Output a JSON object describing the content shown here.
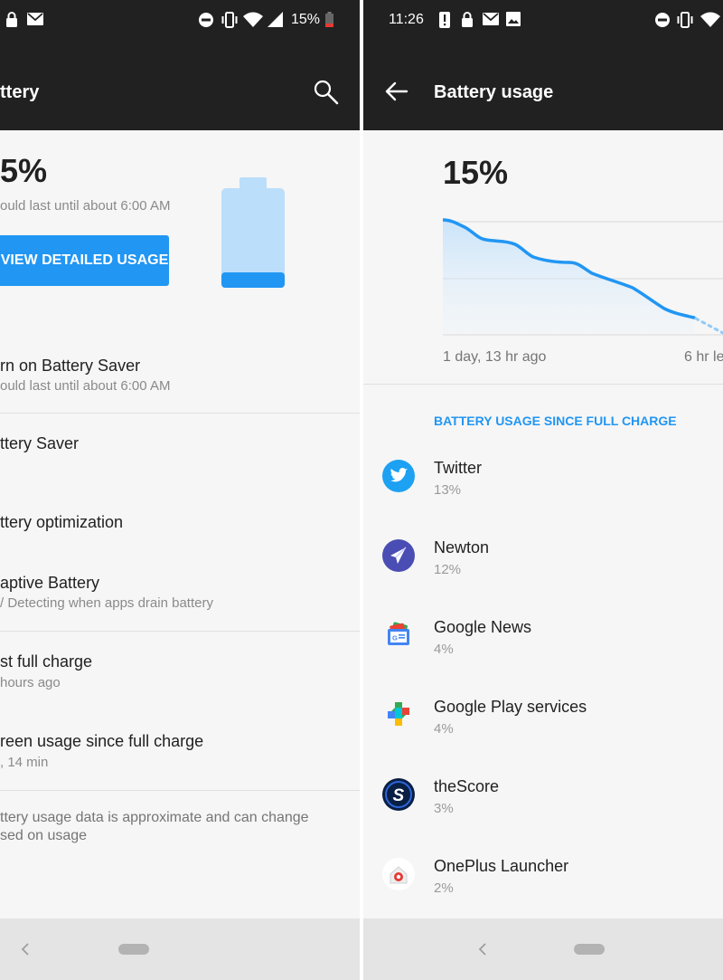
{
  "left": {
    "status": {
      "battery_text": "15%"
    },
    "toolbar": {
      "title": "ttery"
    },
    "summary": {
      "percent": "5%",
      "estimate": "ould last until about 6:00 AM",
      "button_label": "VIEW DETAILED USAGE",
      "battery_level": 0.15
    },
    "items": [
      {
        "title": "rn on Battery Saver",
        "subtitle": "ould last until about 6:00 AM"
      },
      {
        "title": "ttery Saver",
        "subtitle": ""
      },
      {
        "title": "ttery optimization",
        "subtitle": ""
      },
      {
        "title": "aptive Battery",
        "subtitle": "/ Detecting when apps drain battery"
      },
      {
        "title": "st full charge",
        "subtitle": "hours ago"
      },
      {
        "title": "reen usage since full charge",
        "subtitle": ", 14 min"
      }
    ],
    "footnote_line1": "ttery usage data is approximate and can change",
    "footnote_line2": "sed on usage"
  },
  "right": {
    "status": {
      "time": "11:26"
    },
    "toolbar": {
      "title": "Battery usage"
    },
    "summary": {
      "percent": "15%"
    },
    "graph": {
      "start_label": "1 day, 13 hr ago",
      "end_label": "6 hr le"
    },
    "section_header": "BATTERY USAGE SINCE FULL CHARGE",
    "apps": [
      {
        "name": "Twitter",
        "percent": "13%",
        "icon": "twitter-icon"
      },
      {
        "name": "Newton",
        "percent": "12%",
        "icon": "newton-icon"
      },
      {
        "name": "Google News",
        "percent": "4%",
        "icon": "google-news-icon"
      },
      {
        "name": "Google Play services",
        "percent": "4%",
        "icon": "google-play-services-icon"
      },
      {
        "name": "theScore",
        "percent": "3%",
        "icon": "thescore-icon"
      },
      {
        "name": "OnePlus Launcher",
        "percent": "2%",
        "icon": "oneplus-launcher-icon"
      }
    ]
  },
  "colors": {
    "accent": "#2196f3",
    "bar_background": "#212121",
    "battery_light": "#bbdefb"
  }
}
